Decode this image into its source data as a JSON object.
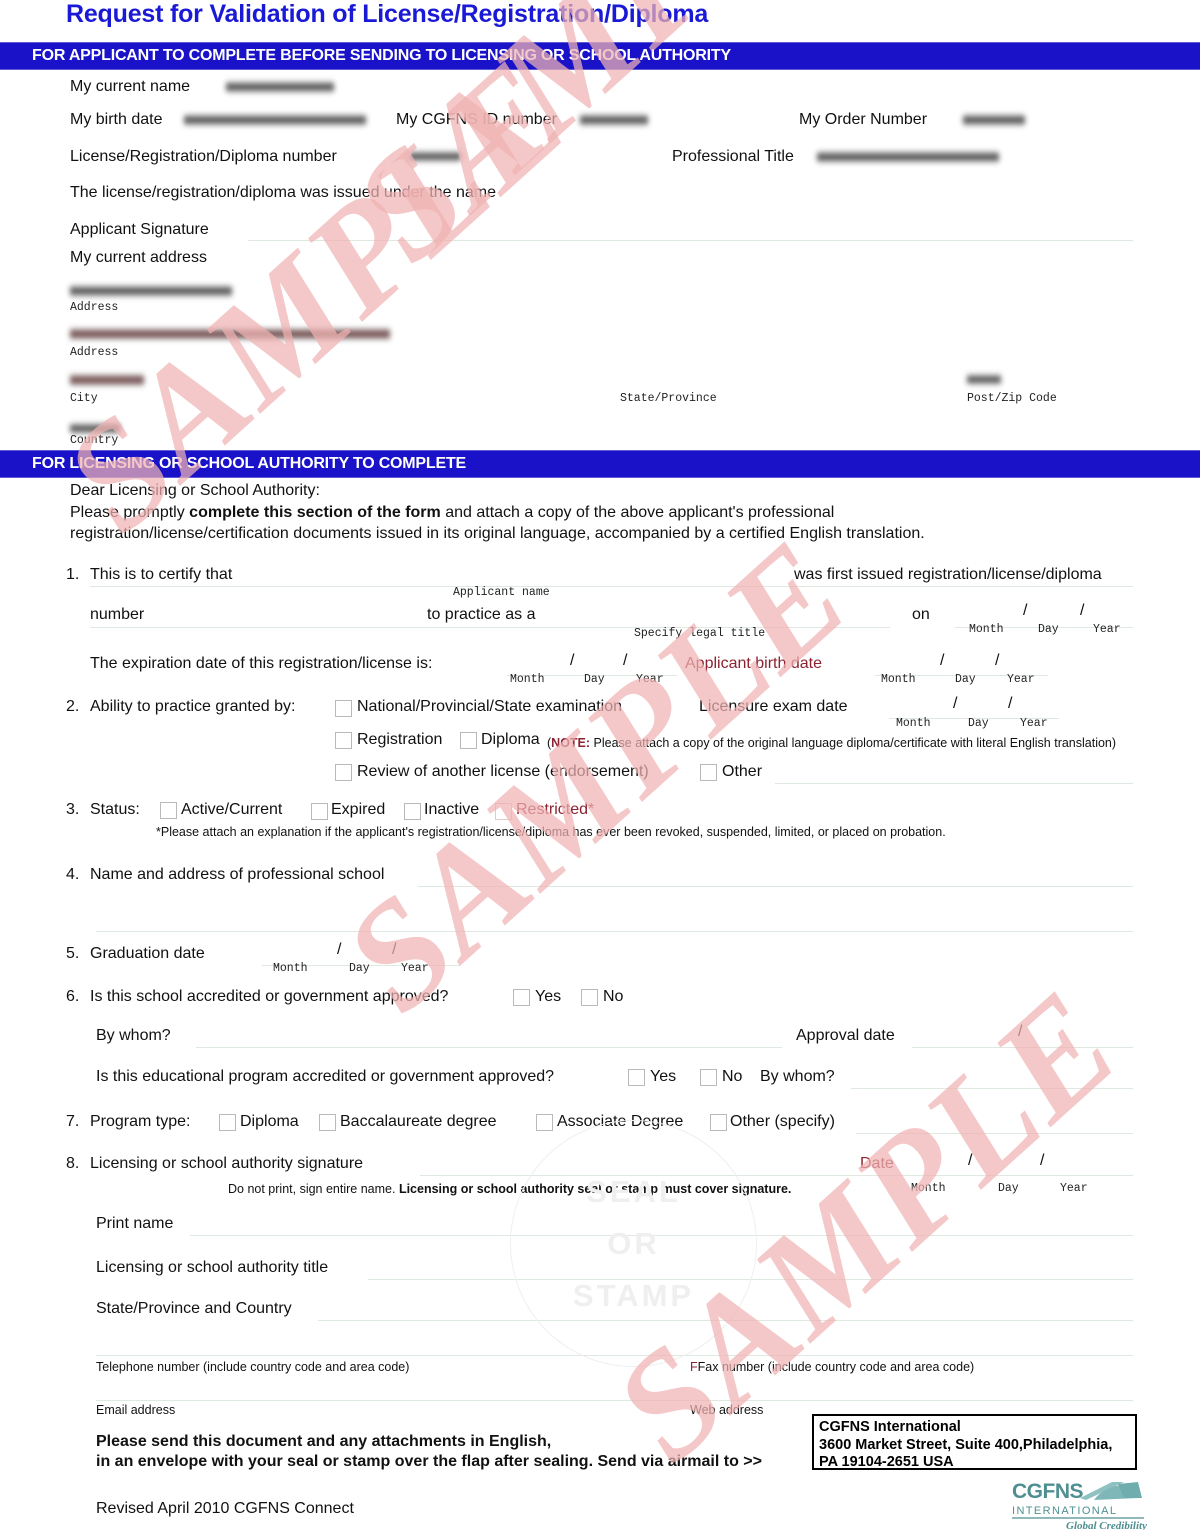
{
  "document": {
    "title": "Request for Validation of License/Registration/Diploma",
    "revision": "Revised April 2010  CGFNS Connect"
  },
  "section_applicant": {
    "header": "FOR APPLICANT TO COMPLETE BEFORE SENDING TO LICENSING OR SCHOOL AUTHORITY",
    "fields": {
      "current_name": "My current name",
      "birth_date": "My birth date",
      "cgfns_id": "My CGFNS ID number",
      "order_number": "My Order Number",
      "license_number": "License/Registration/Diploma number",
      "professional_title": "Professional Title",
      "issued_under_name": "The license/registration/diploma was issued under the name",
      "applicant_signature": "Applicant Signature",
      "current_address": "My current address"
    },
    "address_labels": {
      "address1": "Address",
      "address2": "Address",
      "city": "City",
      "state": "State/Province",
      "zip": "Post/Zip Code",
      "country": "Country"
    }
  },
  "section_authority": {
    "header": "FOR LICENSING OR SCHOOL AUTHORITY TO COMPLETE",
    "salutation": "Dear Licensing or School Authority:",
    "intro_line1_a": "Please promptly ",
    "intro_line1_b": "complete this section of the form",
    "intro_line1_c": " and attach a copy of the above applicant's professional",
    "intro_line2": "registration/license/certification documents issued in its original language, accompanied by a certified English translation.",
    "q1": {
      "num": "1.",
      "text_a": "This is to certify that",
      "text_b": "was first issued registration/license/diploma",
      "applicant_name_label": "Applicant name",
      "number_label": "number",
      "practice_as": "to practice as a",
      "legal_title_label": "Specify legal title",
      "on": "on",
      "month": "Month",
      "day": "Day",
      "year": "Year",
      "expiration_text": "The expiration date of this registration/license is:",
      "applicant_birth_date": "Applicant birth date"
    },
    "q2": {
      "num": "2.",
      "text": "Ability to practice granted by:",
      "opt_exam": "National/Provincial/State examination",
      "licensure_exam_date": "Licensure exam date",
      "opt_registration": "Registration",
      "opt_diploma": "Diploma",
      "note_bold": "NOTE:",
      "note_text": " Please attach a copy of the original language diploma/certificate with literal English translation)",
      "note_open": "(",
      "opt_review": "Review of another license (endorsement)",
      "opt_other": "Other",
      "month": "Month",
      "day": "Day",
      "year": "Year"
    },
    "q3": {
      "num": "3.",
      "text": "Status:",
      "opt_active": "Active/Current",
      "opt_expired": "Expired",
      "opt_inactive": "Inactive",
      "opt_restricted": "Restricted*",
      "footnote": "*Please attach an explanation if the applicant's registration/license/diploma has ever been revoked, suspended,  limited, or placed on probation."
    },
    "q4": {
      "num": "4.",
      "text": "Name and address of professional school"
    },
    "q5": {
      "num": "5.",
      "text": "Graduation date",
      "month": "Month",
      "day": "Day",
      "year": "Year"
    },
    "q6": {
      "num": "6.",
      "text": "Is this school accredited or government approved?",
      "yes": "Yes",
      "no": "No",
      "by_whom": "By whom?",
      "approval_date": "Approval date",
      "program_text": "Is this educational program accredited or government approved?",
      "program_yes": "Yes",
      "program_no": "No",
      "program_by_whom": "By whom?"
    },
    "q7": {
      "num": "7.",
      "text": "Program type:",
      "opt_diploma": "Diploma",
      "opt_bacc": "Baccalaureate degree",
      "opt_assoc": "Associate Degree",
      "opt_other": "Other (specify)"
    },
    "q8": {
      "num": "8.",
      "text": "Licensing or school authority signature",
      "date": "Date",
      "month": "Month",
      "day": "Day",
      "year": "Year",
      "instruction_plain": "Do not print, sign entire name. ",
      "instruction_bold": "Licensing or school authority seal or stamp must cover signature.",
      "print_name": "Print name",
      "authority_title": "Licensing or school authority title",
      "state_country": "State/Province and Country"
    },
    "contact": {
      "telephone": "Telephone number (include country code and area code)",
      "fax": "Fax number (include country code and area code)",
      "email": "Email address",
      "web": "Web address"
    },
    "send_instruction_line1": "Please send this document and any attachments in English,",
    "send_instruction_line2": "in an envelope with your seal or stamp over the flap after sealing. Send via airmail to   >>"
  },
  "cgfns_address": {
    "line1": "CGFNS International",
    "line2": "3600 Market Street, Suite 400,Philadelphia,",
    "line3": "PA 19104-2651 USA"
  },
  "logo": {
    "name": "CGFNS",
    "subtitle": "I N T E R N A T I O N A L",
    "tagline": "Global Credibility"
  },
  "watermark": {
    "text": "SAMPLE",
    "seal_line1": "SEAL",
    "seal_line2": "OR",
    "seal_line3": "STAMP"
  },
  "colors": {
    "title_blue": "#1a1ad6",
    "bar_blue": "#1a12c9",
    "watermark_pink": "#f0b3b3",
    "logo_teal": "#5f9ea0"
  }
}
